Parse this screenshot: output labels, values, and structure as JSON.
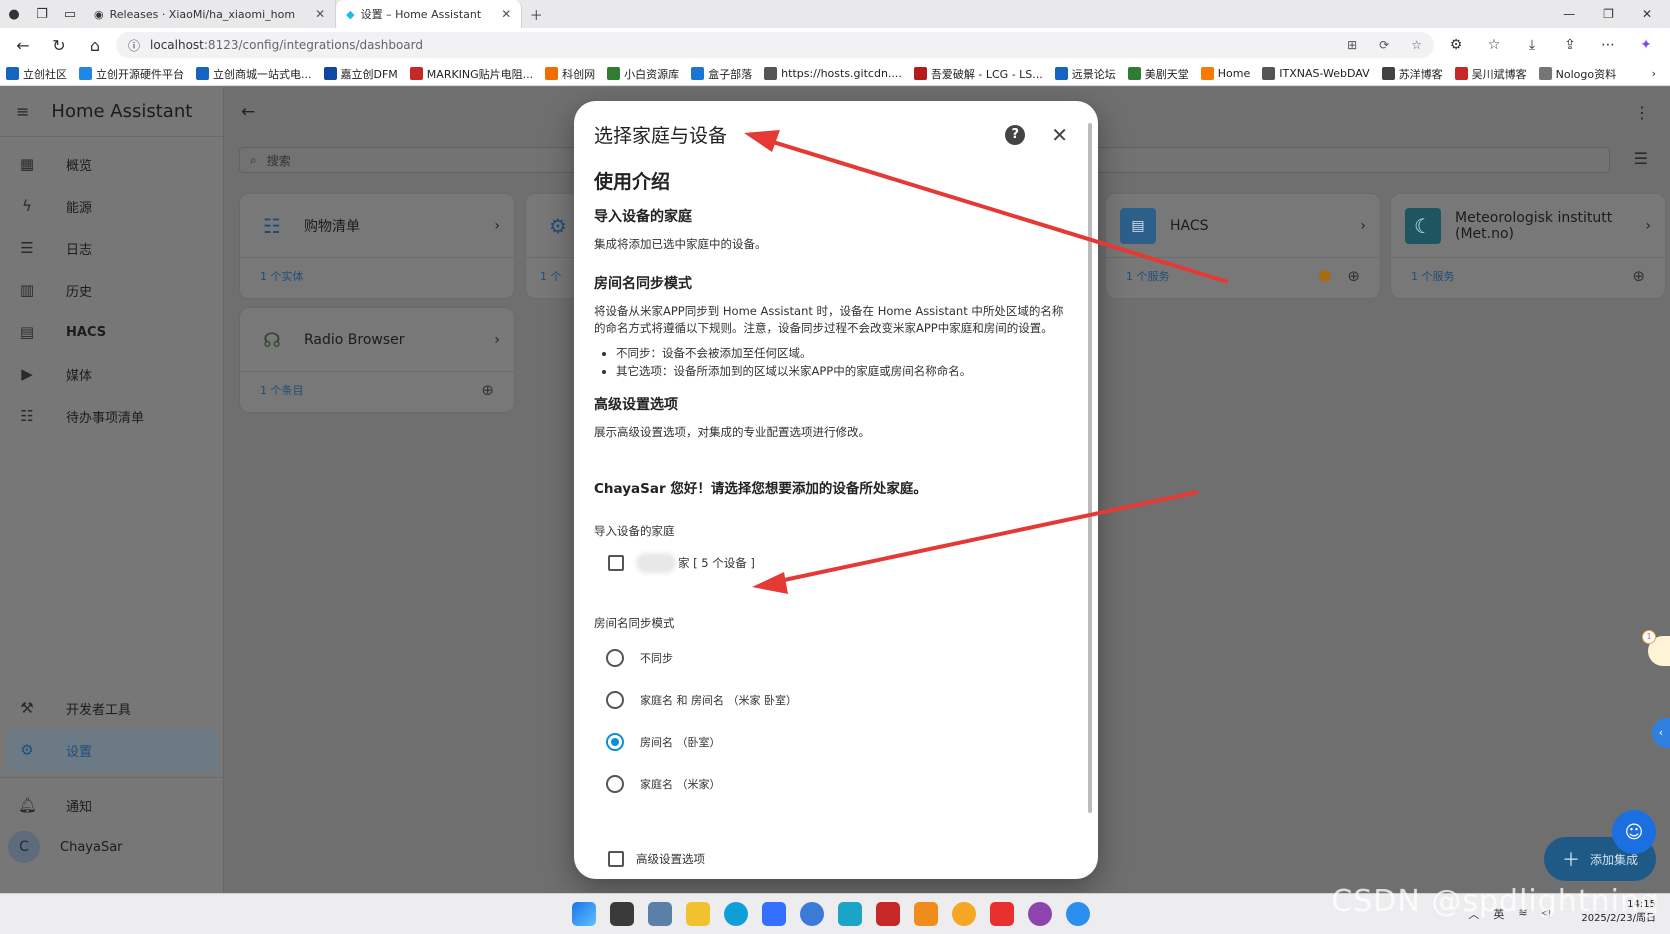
{
  "browser": {
    "tabs": [
      {
        "title": "Releases · XiaoMi/ha_xiaomi_hom",
        "active": false
      },
      {
        "title": "设置 – Home Assistant",
        "active": true
      }
    ],
    "url_host": "localhost",
    "url_rest": ":8123/config/integrations/dashboard",
    "bookmarks": [
      {
        "label": "立创社区",
        "color": "#1565c0"
      },
      {
        "label": "立创开源硬件平台",
        "color": "#1e88e5"
      },
      {
        "label": "立创商城一站式电...",
        "color": "#1565c0"
      },
      {
        "label": "嘉立创DFM",
        "color": "#0d47a1"
      },
      {
        "label": "MARKING贴片电阻...",
        "color": "#c62828"
      },
      {
        "label": "科创网",
        "color": "#ef6c00"
      },
      {
        "label": "小白资源库",
        "color": "#2e7d32"
      },
      {
        "label": "盒子部落",
        "color": "#1976d2"
      },
      {
        "label": "https://hosts.gitcdn....",
        "color": "#555555"
      },
      {
        "label": "吾爱破解 - LCG - LS...",
        "color": "#b71c1c"
      },
      {
        "label": "远景论坛",
        "color": "#1565c0"
      },
      {
        "label": "美剧天堂",
        "color": "#2e7d32"
      },
      {
        "label": "Home",
        "color": "#f57c00"
      },
      {
        "label": "ITXNAS-WebDAV",
        "color": "#555555"
      },
      {
        "label": "苏洋博客",
        "color": "#424242"
      },
      {
        "label": "吴川斌博客",
        "color": "#c62828"
      },
      {
        "label": "Nologo资料",
        "color": "#757575"
      }
    ]
  },
  "ha": {
    "app_title": "Home Assistant",
    "sidebar": [
      {
        "label": "概览",
        "icon": "dashboard-icon",
        "glyph": "▦"
      },
      {
        "label": "能源",
        "icon": "lightning-icon",
        "glyph": "ϟ"
      },
      {
        "label": "日志",
        "icon": "list-icon",
        "glyph": "☰"
      },
      {
        "label": "历史",
        "icon": "chart-icon",
        "glyph": "▥"
      },
      {
        "label": "HACS",
        "icon": "hacs-icon",
        "glyph": "▤"
      },
      {
        "label": "媒体",
        "icon": "media-icon",
        "glyph": "▶"
      },
      {
        "label": "待办事项清单",
        "icon": "clipboard-icon",
        "glyph": "☷"
      }
    ],
    "sidebar_bottom": {
      "dev_tools": "开发者工具",
      "settings": "设置",
      "notifications": "通知",
      "user_name": "ChayaSar",
      "user_initial": "C"
    },
    "search_placeholder": "搜索",
    "cards": [
      {
        "name": "购物清单",
        "footer": "1 个实体",
        "icon": "shopping-list-icon"
      },
      {
        "name": "HACS",
        "footer": "1 个服务",
        "icon": "hacs-icon"
      },
      {
        "name": "Meteorologisk institutt (Met.no)",
        "footer": "1 个服务",
        "icon": "met-icon"
      },
      {
        "name": "Radio Browser",
        "footer": "1 个条目",
        "icon": "radio-icon"
      },
      {
        "partial_footer": "1 个"
      }
    ],
    "fab_label": "添加集成"
  },
  "dialog": {
    "title": "选择家庭与设备",
    "intro_heading": "使用介绍",
    "import_home_heading": "导入设备的家庭",
    "import_home_text": "集成将添加已选中家庭中的设备。",
    "room_sync_heading": "房间名同步模式",
    "room_sync_text": "将设备从米家APP同步到 Home Assistant 时，设备在 Home Assistant 中所处区域的名称的命名方式将遵循以下规则。注意，设备同步过程不会改变米家APP中家庭和房间的设置。",
    "room_sync_bullets": [
      "不同步：设备不会被添加至任何区域。",
      "其它选项：设备所添加到的区域以米家APP中的家庭或房间名称命名。"
    ],
    "advanced_heading": "高级设置选项",
    "advanced_text": "展示高级设置选项，对集成的专业配置选项进行修改。",
    "greeting": "ChayaSar 您好！请选择您想要添加的设备所处家庭。",
    "home_field_label": "导入设备的家庭",
    "home_option": "家 [ 5 个设备 ]",
    "room_field_label": "房间名同步模式",
    "room_options": [
      {
        "label": "不同步",
        "selected": false
      },
      {
        "label": "家庭名 和 房间名 （米家 卧室）",
        "selected": false
      },
      {
        "label": "房间名 （卧室）",
        "selected": true
      },
      {
        "label": "家庭名 （米家）",
        "selected": false
      }
    ],
    "advanced_checkbox": "高级设置选项"
  },
  "taskbar": {
    "time": "14:15",
    "date": "2025/2/23/周日",
    "ime": "英",
    "badge": "1"
  },
  "watermark": "CSDN @spdlightning",
  "colors": {
    "accent": "#0a8fd6",
    "annotation_arrow": "#e53935",
    "ha_blue": "#1e4e78"
  }
}
